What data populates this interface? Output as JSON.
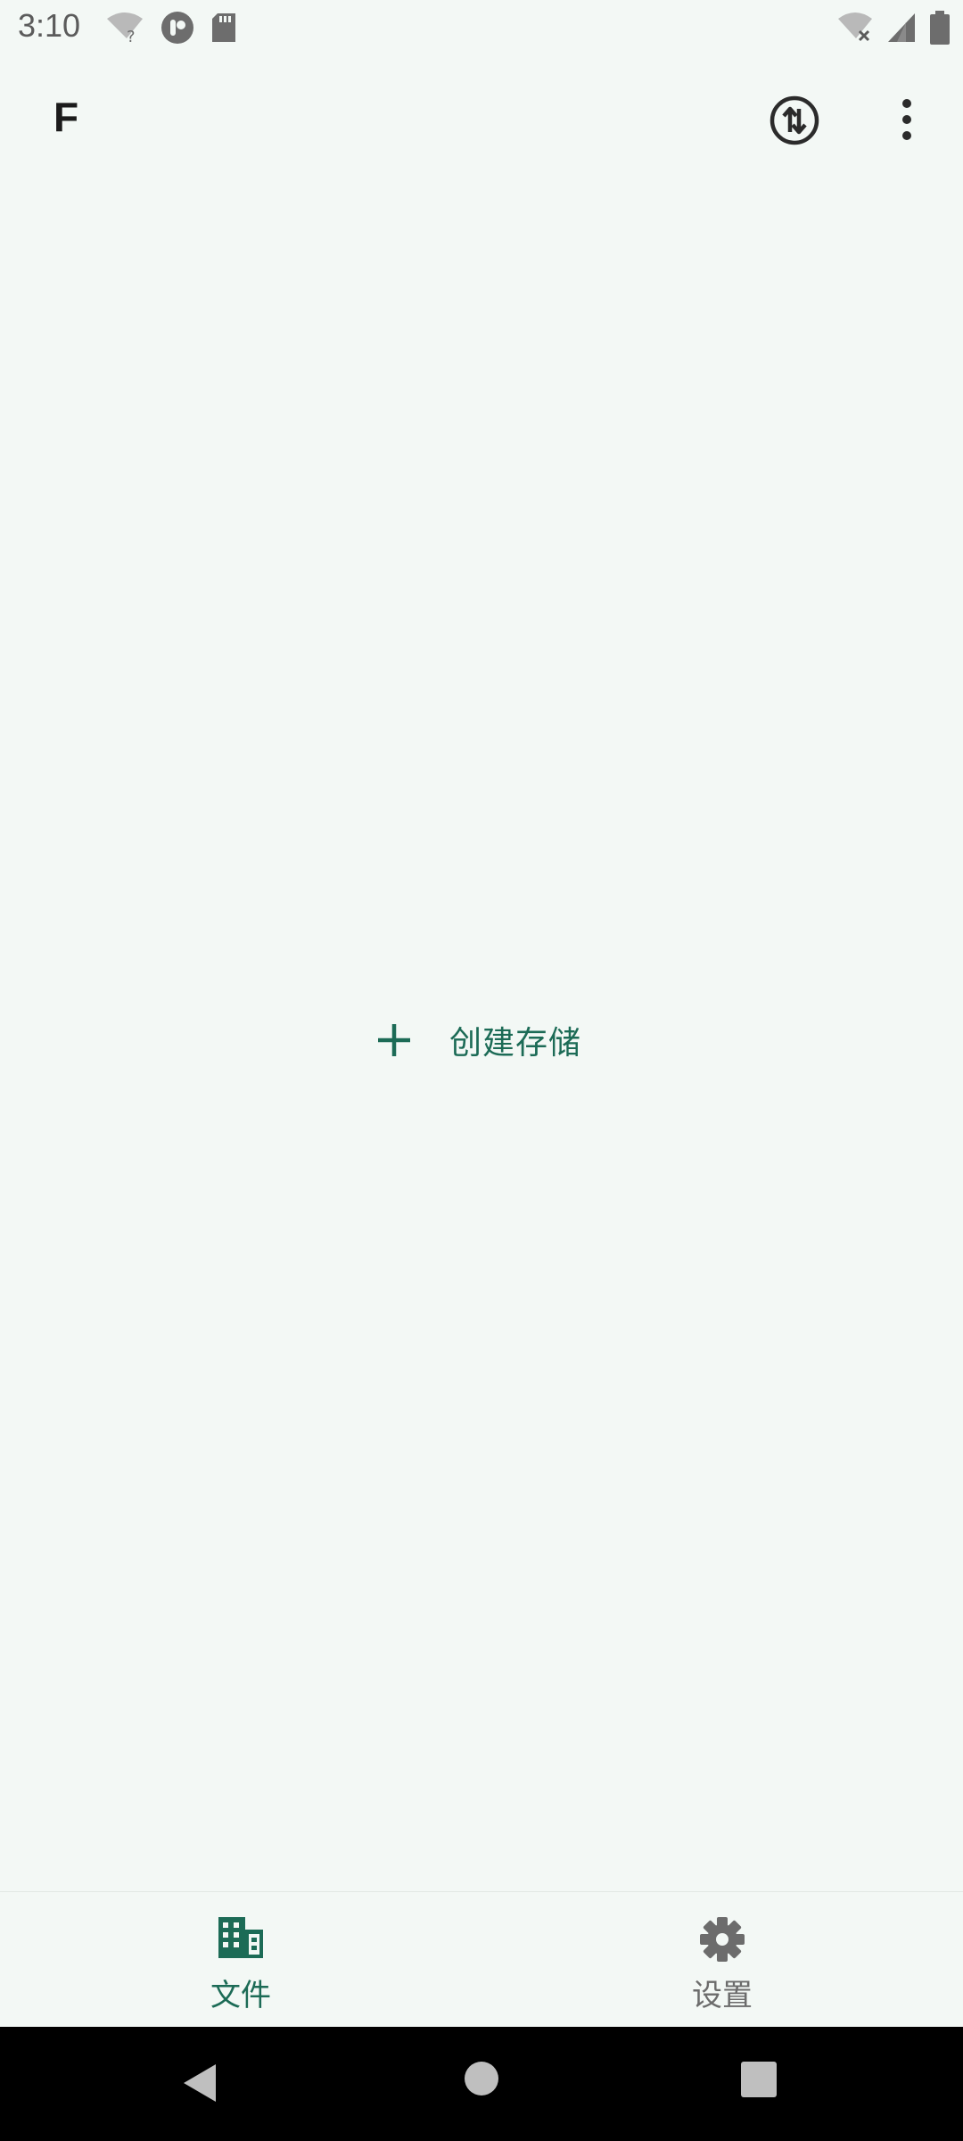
{
  "status_bar": {
    "time": "3:10",
    "left_icons": [
      "wifi-unknown-icon",
      "app-notification-icon",
      "sd-card-icon"
    ],
    "right_icons": [
      "wifi-off-icon",
      "cellular-signal-icon",
      "battery-icon"
    ]
  },
  "app_bar": {
    "title": "F",
    "sync_icon": "sync-arrows-icon",
    "more_icon": "more-vert-icon"
  },
  "main": {
    "create_storage_label": "创建存储",
    "create_icon": "plus-icon"
  },
  "bottom_nav": {
    "items": [
      {
        "label": "文件",
        "icon": "files-building-icon",
        "active": true
      },
      {
        "label": "设置",
        "icon": "gear-icon",
        "active": false
      }
    ]
  },
  "colors": {
    "background": "#f3f8f5",
    "accent": "#1c6b56",
    "inactive": "#6c6c6c"
  }
}
